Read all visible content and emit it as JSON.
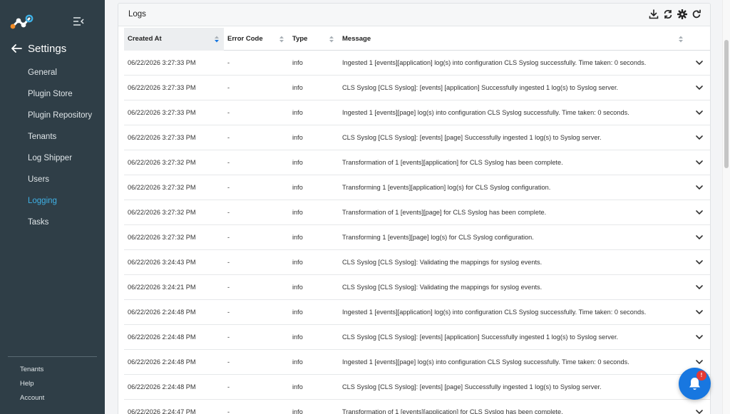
{
  "sidebar": {
    "settings_title": "Settings",
    "nav": [
      {
        "label": "General",
        "active": false
      },
      {
        "label": "Plugin Store",
        "active": false
      },
      {
        "label": "Plugin Repository",
        "active": false
      },
      {
        "label": "Tenants",
        "active": false
      },
      {
        "label": "Log Shipper",
        "active": false
      },
      {
        "label": "Users",
        "active": false
      },
      {
        "label": "Logging",
        "active": true
      },
      {
        "label": "Tasks",
        "active": false
      }
    ],
    "bottom_links": [
      "Tenants",
      "Help",
      "Account"
    ],
    "accent_color": "#3fb1e6"
  },
  "panel": {
    "title": "Logs",
    "toolbar_icons": [
      "download-icon",
      "sync-icon",
      "gear-icon",
      "refresh-icon"
    ]
  },
  "table": {
    "columns": [
      "Created At",
      "Error Code",
      "Type",
      "Message"
    ],
    "sorted_column": "Created At",
    "rows": [
      {
        "created_at": "06/22/2026 3:27:33 PM",
        "error_code": "-",
        "type": "info",
        "message": "Ingested 1 [events][application] log(s) into configuration CLS Syslog successfully. Time taken: 0 seconds."
      },
      {
        "created_at": "06/22/2026 3:27:33 PM",
        "error_code": "-",
        "type": "info",
        "message": "CLS Syslog [CLS Syslog]: [events] [application] Successfully ingested 1 log(s) to Syslog server."
      },
      {
        "created_at": "06/22/2026 3:27:33 PM",
        "error_code": "-",
        "type": "info",
        "message": "Ingested 1 [events][page] log(s) into configuration CLS Syslog successfully. Time taken: 0 seconds."
      },
      {
        "created_at": "06/22/2026 3:27:33 PM",
        "error_code": "-",
        "type": "info",
        "message": "CLS Syslog [CLS Syslog]: [events] [page] Successfully ingested 1 log(s) to Syslog server."
      },
      {
        "created_at": "06/22/2026 3:27:32 PM",
        "error_code": "-",
        "type": "info",
        "message": "Transformation of 1 [events][application] for CLS Syslog has been complete."
      },
      {
        "created_at": "06/22/2026 3:27:32 PM",
        "error_code": "-",
        "type": "info",
        "message": "Transforming 1 [events][application] log(s) for CLS Syslog configuration."
      },
      {
        "created_at": "06/22/2026 3:27:32 PM",
        "error_code": "-",
        "type": "info",
        "message": "Transformation of 1 [events][page] for CLS Syslog has been complete."
      },
      {
        "created_at": "06/22/2026 3:27:32 PM",
        "error_code": "-",
        "type": "info",
        "message": "Transforming 1 [events][page] log(s) for CLS Syslog configuration."
      },
      {
        "created_at": "06/22/2026 3:24:43 PM",
        "error_code": "-",
        "type": "info",
        "message": "CLS Syslog [CLS Syslog]: Validating the mappings for syslog events."
      },
      {
        "created_at": "06/22/2026 3:24:21 PM",
        "error_code": "-",
        "type": "info",
        "message": "CLS Syslog [CLS Syslog]: Validating the mappings for syslog events."
      },
      {
        "created_at": "06/22/2026 2:24:48 PM",
        "error_code": "-",
        "type": "info",
        "message": "Ingested 1 [events][application] log(s) into configuration CLS Syslog successfully. Time taken: 0 seconds."
      },
      {
        "created_at": "06/22/2026 2:24:48 PM",
        "error_code": "-",
        "type": "info",
        "message": "CLS Syslog [CLS Syslog]: [events] [application] Successfully ingested 1 log(s) to Syslog server."
      },
      {
        "created_at": "06/22/2026 2:24:48 PM",
        "error_code": "-",
        "type": "info",
        "message": "Ingested 1 [events][page] log(s) into configuration CLS Syslog successfully. Time taken: 0 seconds."
      },
      {
        "created_at": "06/22/2026 2:24:48 PM",
        "error_code": "-",
        "type": "info",
        "message": "CLS Syslog [CLS Syslog]: [events] [page] Successfully ingested 1 log(s) to Syslog server."
      },
      {
        "created_at": "06/22/2026 2:24:47 PM",
        "error_code": "-",
        "type": "info",
        "message": "Transformation of 1 [events][application] for CLS Syslog has been complete."
      }
    ]
  },
  "notifications": {
    "badge": "!"
  }
}
